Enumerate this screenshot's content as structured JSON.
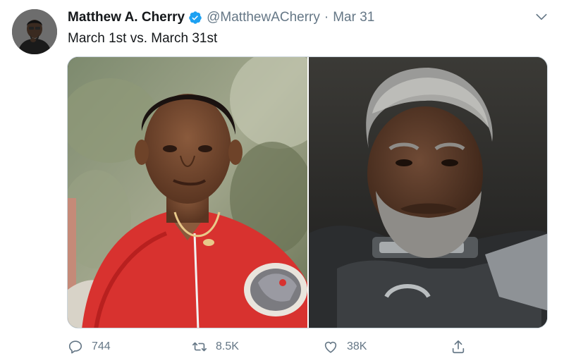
{
  "tweet": {
    "author_name": "Matthew A. Cherry",
    "handle": "@MatthewACherry",
    "separator": "·",
    "date": "Mar 31",
    "text": "March 1st vs. March 31st"
  },
  "media": {
    "images": [
      "young-man-red-jacket-photo",
      "older-man-gray-beard-armor-photo"
    ]
  },
  "actions": {
    "reply_count": "744",
    "retweet_count": "8.5K",
    "like_count": "38K"
  },
  "icons": {
    "verified": "verified-badge-icon",
    "caret": "chevron-down-icon",
    "reply": "reply-icon",
    "retweet": "retweet-icon",
    "like": "heart-icon",
    "share": "share-icon"
  },
  "colors": {
    "accent": "#1da1f2",
    "secondary_text": "#657786",
    "primary_text": "#14171a",
    "border": "#ccd6dd"
  }
}
